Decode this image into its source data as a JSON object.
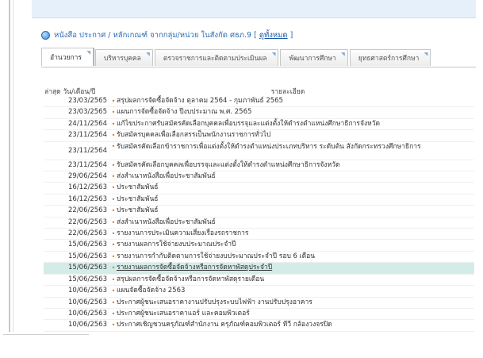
{
  "header": {
    "title": "หนังสือ ประกาศ / หลักเกณฑ์ จากกลุ่ม/หน่วย ในสังกัด ศธภ.9 [",
    "all_link": "ดูทั้งหมด",
    "close": "]"
  },
  "tabs": [
    {
      "label": "อำนวยการ"
    },
    {
      "label": "บริหารบุคคล"
    },
    {
      "label": "ตรวจราชการและติดตามประเมินผล"
    },
    {
      "label": "พัฒนาการศึกษา"
    },
    {
      "label": "ยุทธศาสตร์การศึกษา"
    }
  ],
  "table": {
    "col_date": "ล่าสุด วัน/เดือน/ปี",
    "col_detail": "รายละเอียด",
    "rows": [
      {
        "date": "23/03/2565",
        "text": "สรุปผลการจัดซื้อจัดจ้าง ตุลาคม 2564 - กุมภาพันธ์ 2565"
      },
      {
        "date": "23/03/2565",
        "text": "แผนการจัดซื้อจัดจ้าง ปีงบประมาณ พ.ศ. 2565"
      },
      {
        "date": "24/11/2564",
        "text": "แก้ไขประกาศรับสมัครคัดเลือกบุคคลเพื่อบรรจุและแต่งตั้งให้ดำรงตำแหน่งศึกษาธิการจังหวัด"
      },
      {
        "date": "23/11/2564",
        "text": "รับสมัครบุคคลเพื่อเลือกสรรเป็นพนักงานราชการทั่วไป"
      },
      {
        "date": "23/11/2564",
        "text": "รับสมัครคัดเลือกข้าราชการเพื่อแต่งตั้งให้ดำรงตำแหน่งประเภทบริหาร ระดับต้น สังกัดกระทรวงศึกษาธิการ"
      },
      {
        "date": "23/11/2564",
        "text": "รับสมัครคัดเลือกบุคคลเพื่อบรรจุและแต่งตั้งให้ดำรงตำแหน่งศึกษาธิการจังหวัด"
      },
      {
        "date": "29/06/2564",
        "text": "ส่งสำเนาหนังสือเพื่อประชาสัมพันธ์"
      },
      {
        "date": "16/12/2563",
        "text": "ประชาสัมพันธ์"
      },
      {
        "date": "16/12/2563",
        "text": "ประชาสัมพันธ์"
      },
      {
        "date": "22/06/2563",
        "text": "ประชาสัมพันธ์"
      },
      {
        "date": "22/06/2563",
        "text": "ส่งสำเนาหนังสือเพื่อประชาสัมพันธ์"
      },
      {
        "date": "22/06/2563",
        "text": "รายงานการประเมินความเสี่ยงเรื่องรถราชการ"
      },
      {
        "date": "15/06/2563",
        "text": "รายงานผลการใช้จ่ายงบประมาณประจำปี"
      },
      {
        "date": "15/06/2563",
        "text": "รายงานการกำกับติดตามการใช้จ่ายงบประมาณประจำปี รอบ 6 เดือน"
      },
      {
        "date": "15/06/2563",
        "text": "รายงานผลการจัดซื้อจัดจ้างหรือการจัดหาพัสดุประจำปี"
      },
      {
        "date": "15/06/2563",
        "text": "สรุปผลการจัดซื้อจัดจ้างหรือการจัดหาพัสดุรายเดือน"
      },
      {
        "date": "10/06/2563",
        "text": "แผนจัดซื้อจัดจ้าง 2563"
      },
      {
        "date": "10/06/2563",
        "text": "ประกาศผู้ชนะเสนอราคางานปรับปรุงระบบไฟฟ้า งานปรับปรุงอาคาร"
      },
      {
        "date": "10/06/2563",
        "text": "ประกาศผู้ชนะเสนอราคาแอร์ และคอมพิวเตอร์"
      },
      {
        "date": "10/06/2563",
        "text": "ประกาศเชิญชวนครุภัณฑ์สำนักงาน ครุภัณฑ์คอมพิวเตอร์ ทีวี กล้องวงจรปิด"
      }
    ]
  },
  "colors": {
    "highlight": "#d4ece8",
    "bullet": "#e07a1a",
    "link": "#1a57a6"
  }
}
